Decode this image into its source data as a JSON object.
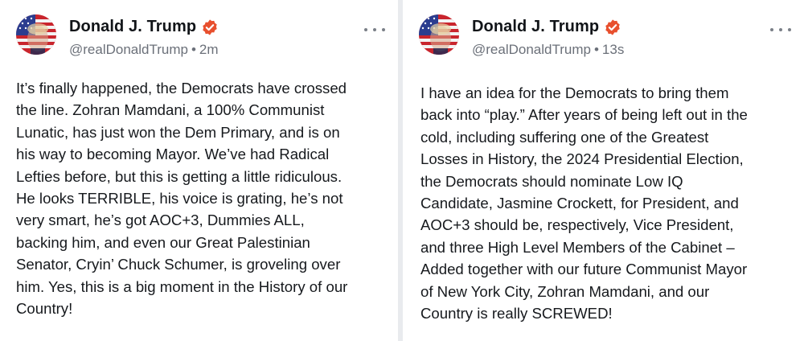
{
  "posts": [
    {
      "author": {
        "name": "Donald J. Trump",
        "handle": "@realDonaldTrump",
        "time": "2m",
        "verified": true,
        "avatar_icon": "flag-portrait-avatar"
      },
      "text": "It’s finally happened, the Democrats have crossed\nthe line. Zohran Mamdani, a 100% Communist\nLunatic, has just won the Dem Primary, and is on\nhis way to becoming Mayor. We’ve had Radical\nLefties before, but this is getting a little ridiculous.\nHe looks TERRIBLE, his voice is grating, he’s not\nvery smart, he’s got AOC+3, Dummies ALL,\nbacking him, and even our Great Palestinian\nSenator, Cryin’ Chuck Schumer, is groveling over\nhim. Yes, this is a big moment in the History of our\nCountry!"
    },
    {
      "author": {
        "name": "Donald J. Trump",
        "handle": "@realDonaldTrump",
        "time": "13s",
        "verified": true,
        "avatar_icon": "flag-portrait-avatar"
      },
      "text": "I have an idea for the Democrats to bring them\nback into “play.” After years of being left out in the\ncold, including suffering one of the Greatest\nLosses in History, the 2024 Presidential Election,\nthe Democrats should nominate Low IQ\nCandidate, Jasmine Crockett, for President, and\nAOC+3 should be, respectively, Vice President,\nand three High Level Members of the Cabinet –\nAdded together with our future Communist Mayor\nof New York City, Zohran Mamdani, and our\nCountry is really SCREWED!"
    }
  ],
  "colors": {
    "verified_badge": "#e8502e",
    "handle_gray": "#6b7079",
    "divider": "#e9ebee"
  },
  "separator_dot": "•"
}
